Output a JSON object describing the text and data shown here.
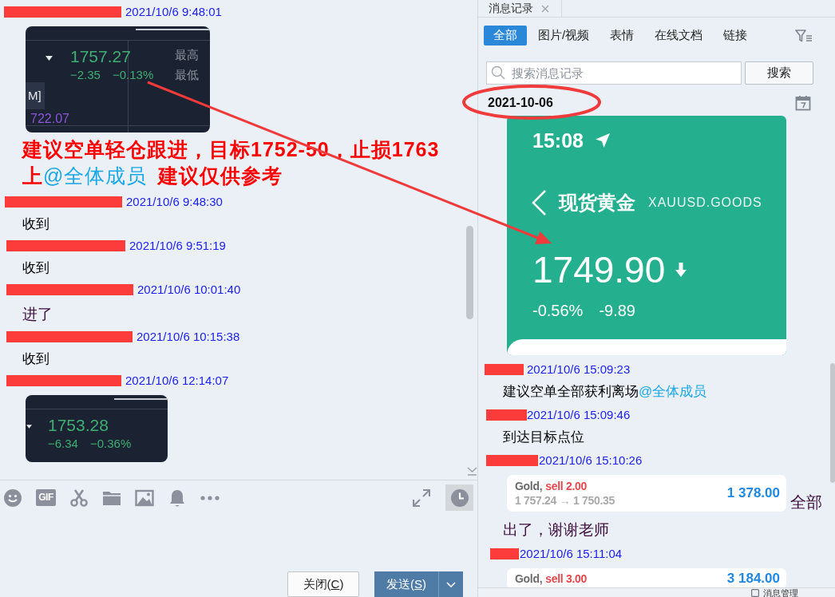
{
  "chat": {
    "messages": [
      {
        "sender_redacted": true,
        "time": "2021/10/6 9:48:01",
        "body": [
          {
            "kind": "quote_image",
            "price": "1757.27",
            "change": "−2.35",
            "percent": "−0.13%",
            "high_label": "最高",
            "low_label": "最低",
            "tag": "M]",
            "level_value": "722.07"
          },
          {
            "kind": "alert_text",
            "color": "#ff0000",
            "segments": [
              {
                "kind": "text",
                "text": "建议空单轻仓跟进，目标1752-50，止损1763上"
              },
              {
                "kind": "mention",
                "text": "@全体成员"
              },
              {
                "kind": "text",
                "text": "建议仅供参考"
              }
            ]
          }
        ]
      },
      {
        "sender_redacted": true,
        "time": "2021/10/6 9:48:30",
        "body": [
          {
            "kind": "text",
            "color": "#000000",
            "segments": [
              {
                "kind": "text",
                "text": "收到"
              }
            ]
          }
        ]
      },
      {
        "sender_redacted": true,
        "time": "2021/10/6 9:51:19",
        "body": [
          {
            "kind": "text",
            "color": "#000000",
            "segments": [
              {
                "kind": "text",
                "text": "收到"
              }
            ]
          }
        ]
      },
      {
        "sender_redacted": true,
        "time": "2021/10/6 10:01:40",
        "body": [
          {
            "kind": "custom_text",
            "color": "#3a0a3a",
            "segments": [
              {
                "kind": "text",
                "text": "进了"
              }
            ]
          }
        ]
      },
      {
        "sender_redacted": true,
        "time": "2021/10/6 10:15:38",
        "body": [
          {
            "kind": "text",
            "color": "#000000",
            "segments": [
              {
                "kind": "text",
                "text": "收到"
              }
            ]
          }
        ]
      },
      {
        "sender_redacted": true,
        "time": "2021/10/6 12:14:07",
        "body": [
          {
            "kind": "quote_image",
            "price": "1753.28",
            "change": "−6.34",
            "percent": "−0.36%"
          }
        ]
      }
    ]
  },
  "toolbar": {
    "gif_label": "GIF"
  },
  "buttons": [
    {
      "kind": "close",
      "label_before": "关闭(",
      "access_key": "C",
      "label_after": ")"
    },
    {
      "kind": "send",
      "label_before": "发送(",
      "access_key": "S",
      "label_after": ")"
    }
  ],
  "history": {
    "tab": {
      "title": "消息记录"
    },
    "filters": [
      {
        "label": "全部",
        "selected": true
      },
      {
        "label": "图片/视频",
        "selected": false
      },
      {
        "label": "表情",
        "selected": false
      },
      {
        "label": "在线文档",
        "selected": false
      },
      {
        "label": "链接",
        "selected": false
      }
    ],
    "search": {
      "placeholder": "搜索消息记录",
      "button": "搜索"
    },
    "date": "2021-10-06",
    "messages": [
      {
        "body": [
          {
            "kind": "phone_image",
            "clock": "15:08",
            "title": "现货黄金",
            "symbol": "XAUUSD.GOODS",
            "price": "1749.90",
            "percent": "-0.56%",
            "change": "-9.89"
          }
        ]
      },
      {
        "sender_redacted": true,
        "time": "2021/10/6 15:09:23",
        "body": [
          {
            "kind": "text",
            "color": "#000000",
            "segments": [
              {
                "kind": "text",
                "text": "建议空单全部获利离场"
              },
              {
                "kind": "mention",
                "text": "@全体成员"
              }
            ]
          }
        ]
      },
      {
        "sender_redacted": true,
        "time": "2021/10/6 15:09:46",
        "body": [
          {
            "kind": "text",
            "color": "#000000",
            "segments": [
              {
                "kind": "text",
                "text": "到达目标点位"
              }
            ]
          }
        ]
      },
      {
        "sender_redacted": true,
        "time": "2021/10/6 15:10:26",
        "body": [
          {
            "kind": "trade_card",
            "symbol": "Gold,",
            "order": "sell 2.00",
            "prices": "1 757.24 → 1 750.35",
            "profit": "1 378.00",
            "caption": {
              "text": "全部",
              "color": "#3a0a3a"
            }
          },
          {
            "kind": "custom_text",
            "color": "#3a0a3a",
            "segments": [
              {
                "kind": "text",
                "text": "出了，谢谢老师"
              }
            ]
          }
        ]
      },
      {
        "sender_redacted": true,
        "time": "2021/10/6 15:11:04",
        "body": [
          {
            "kind": "trade_card",
            "symbol": "Gold,",
            "order": "sell 3.00",
            "profit": "3 184.00"
          }
        ]
      }
    ],
    "footer": {
      "button": "消息管理"
    }
  }
}
